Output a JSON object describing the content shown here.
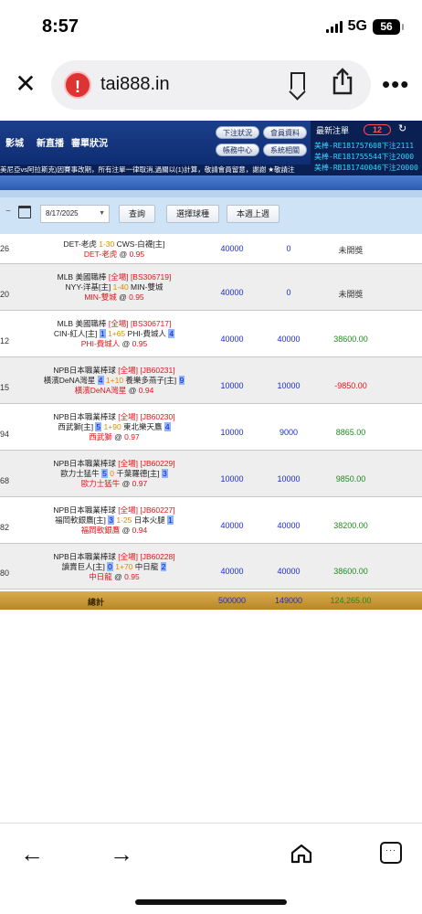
{
  "status": {
    "time": "8:57",
    "network": "5G",
    "battery": "56"
  },
  "browser": {
    "url": "tai888.in"
  },
  "header": {
    "nav": [
      "影城",
      "新直播",
      "審單狀況"
    ],
    "buttons_row1": [
      "下注狀況",
      "會員資料"
    ],
    "buttons_row2": [
      "帳務中心",
      "系統相關"
    ],
    "latest_title": "最新注單",
    "latest_count": "12",
    "latest_lines": [
      "美棒-RE181757608下注2111",
      "美棒-RE181755544下注2000",
      "美棒-RB181740046下注20000"
    ],
    "marquee": "美尼亞vs阿拉斯克)因賽事改期，所有注單一律取消,過關以(1)計算，敬請會員留意，謝謝 ★敬請注"
  },
  "filter": {
    "dash": "~",
    "date": "8/17/2025",
    "query_label": "查詢",
    "select_sport_label": "選擇球種",
    "this_week_label": "本週上週"
  },
  "rows": [
    {
      "id": "26",
      "lines": [
        [
          {
            "t": "DET-老虎 "
          },
          {
            "t": "1-30",
            "c": "org"
          },
          {
            "t": " CWS-白襪[主]"
          }
        ],
        [
          {
            "t": "DET-老虎",
            "c": "red"
          },
          {
            "t": " @ "
          },
          {
            "t": "0.95",
            "c": "red"
          }
        ]
      ],
      "bet": "40000",
      "valid": "0",
      "result": "未開獎",
      "result_class": "dark"
    },
    {
      "id": "20",
      "lines": [
        [
          {
            "t": "MLB 美國職棒 "
          },
          {
            "t": "[全場]",
            "c": "red"
          },
          {
            "t": " "
          },
          {
            "t": "[BS306719]",
            "c": "red"
          }
        ],
        [
          {
            "t": "NYY-洋基[主] "
          },
          {
            "t": "1-40",
            "c": "org"
          },
          {
            "t": " MIN-雙城"
          }
        ],
        [
          {
            "t": "MIN-雙城",
            "c": "red"
          },
          {
            "t": " @ "
          },
          {
            "t": "0.95",
            "c": "red"
          }
        ]
      ],
      "bet": "40000",
      "valid": "0",
      "result": "未開獎",
      "result_class": "dark"
    },
    {
      "id": "12",
      "lines": [
        [
          {
            "t": "MLB 美國職棒 "
          },
          {
            "t": "[全場]",
            "c": "red"
          },
          {
            "t": " "
          },
          {
            "t": "[BS306717]",
            "c": "red"
          }
        ],
        [
          {
            "t": "CIN-紅人[主] "
          },
          {
            "t": "1",
            "c": "blue-bg"
          },
          {
            "t": " "
          },
          {
            "t": "1+65",
            "c": "org"
          },
          {
            "t": " PHI-費城人 "
          },
          {
            "t": "4",
            "c": "blue-bg"
          }
        ],
        [
          {
            "t": "PHI-費城人",
            "c": "red"
          },
          {
            "t": " @ "
          },
          {
            "t": "0.95",
            "c": "red"
          }
        ]
      ],
      "bet": "40000",
      "valid": "40000",
      "result": "38600.00",
      "result_class": "green"
    },
    {
      "id": "15",
      "lines": [
        [
          {
            "t": "NPB日本職業棒球 "
          },
          {
            "t": "[全場]",
            "c": "red"
          },
          {
            "t": " "
          },
          {
            "t": "[JB60231]",
            "c": "red"
          }
        ],
        [
          {
            "t": "橫濱DeNA灣星 "
          },
          {
            "t": "4",
            "c": "blue-bg"
          },
          {
            "t": " "
          },
          {
            "t": "1+10",
            "c": "org"
          },
          {
            "t": " 養樂多燕子[主] "
          },
          {
            "t": "9",
            "c": "blue-bg"
          }
        ],
        [
          {
            "t": "橫濱DeNA灣星",
            "c": "red"
          },
          {
            "t": " @ "
          },
          {
            "t": "0.94",
            "c": "red"
          }
        ]
      ],
      "bet": "10000",
      "valid": "10000",
      "result": "-9850.00",
      "result_class": "neg"
    },
    {
      "id": "94",
      "lines": [
        [
          {
            "t": "NPB日本職業棒球 "
          },
          {
            "t": "[全場]",
            "c": "red"
          },
          {
            "t": " "
          },
          {
            "t": "[JB60230]",
            "c": "red"
          }
        ],
        [
          {
            "t": "西武獅[主] "
          },
          {
            "t": "5",
            "c": "blue-bg"
          },
          {
            "t": " "
          },
          {
            "t": "1+90",
            "c": "org"
          },
          {
            "t": " 東北樂天鷹 "
          },
          {
            "t": "4",
            "c": "blue-bg"
          }
        ],
        [
          {
            "t": "西武獅",
            "c": "red"
          },
          {
            "t": " @ "
          },
          {
            "t": "0.97",
            "c": "red"
          }
        ]
      ],
      "bet": "10000",
      "valid": "9000",
      "result": "8865.00",
      "result_class": "green"
    },
    {
      "id": "68",
      "lines": [
        [
          {
            "t": "NPB日本職業棒球 "
          },
          {
            "t": "[全場]",
            "c": "red"
          },
          {
            "t": " "
          },
          {
            "t": "[JB60229]",
            "c": "red"
          }
        ],
        [
          {
            "t": "歐力士猛牛 "
          },
          {
            "t": "5",
            "c": "blue-bg"
          },
          {
            "t": " "
          },
          {
            "t": "0",
            "c": "org"
          },
          {
            "t": " 千葉羅德[主] "
          },
          {
            "t": "3",
            "c": "blue-bg"
          }
        ],
        [
          {
            "t": "歐力士猛牛",
            "c": "red"
          },
          {
            "t": " @ "
          },
          {
            "t": "0.97",
            "c": "red"
          }
        ]
      ],
      "bet": "10000",
      "valid": "10000",
      "result": "9850.00",
      "result_class": "green"
    },
    {
      "id": "82",
      "lines": [
        [
          {
            "t": "NPB日本職業棒球 "
          },
          {
            "t": "[全場]",
            "c": "red"
          },
          {
            "t": " "
          },
          {
            "t": "[JB60227]",
            "c": "red"
          }
        ],
        [
          {
            "t": "福岡軟銀鷹[主] "
          },
          {
            "t": "3",
            "c": "blue-bg"
          },
          {
            "t": " "
          },
          {
            "t": "1-25",
            "c": "org"
          },
          {
            "t": " 日本火腿 "
          },
          {
            "t": "1",
            "c": "blue-bg"
          }
        ],
        [
          {
            "t": "福岡軟銀鷹",
            "c": "red"
          },
          {
            "t": " @ "
          },
          {
            "t": "0.94",
            "c": "red"
          }
        ]
      ],
      "bet": "40000",
      "valid": "40000",
      "result": "38200.00",
      "result_class": "green"
    },
    {
      "id": "80",
      "lines": [
        [
          {
            "t": "NPB日本職業棒球 "
          },
          {
            "t": "[全場]",
            "c": "red"
          },
          {
            "t": " "
          },
          {
            "t": "[JB60228]",
            "c": "red"
          }
        ],
        [
          {
            "t": "讀賣巨人[主] "
          },
          {
            "t": "0",
            "c": "blue-bg"
          },
          {
            "t": " "
          },
          {
            "t": "1+70",
            "c": "org"
          },
          {
            "t": " 中日龍 "
          },
          {
            "t": "2",
            "c": "blue-bg"
          }
        ],
        [
          {
            "t": "中日龍",
            "c": "red"
          },
          {
            "t": " @ "
          },
          {
            "t": "0.95",
            "c": "red"
          }
        ]
      ],
      "bet": "40000",
      "valid": "40000",
      "result": "38600.00",
      "result_class": "green"
    }
  ],
  "total": {
    "label": "總計",
    "bet": "500000",
    "valid": "149000",
    "result": "124,265.00"
  }
}
